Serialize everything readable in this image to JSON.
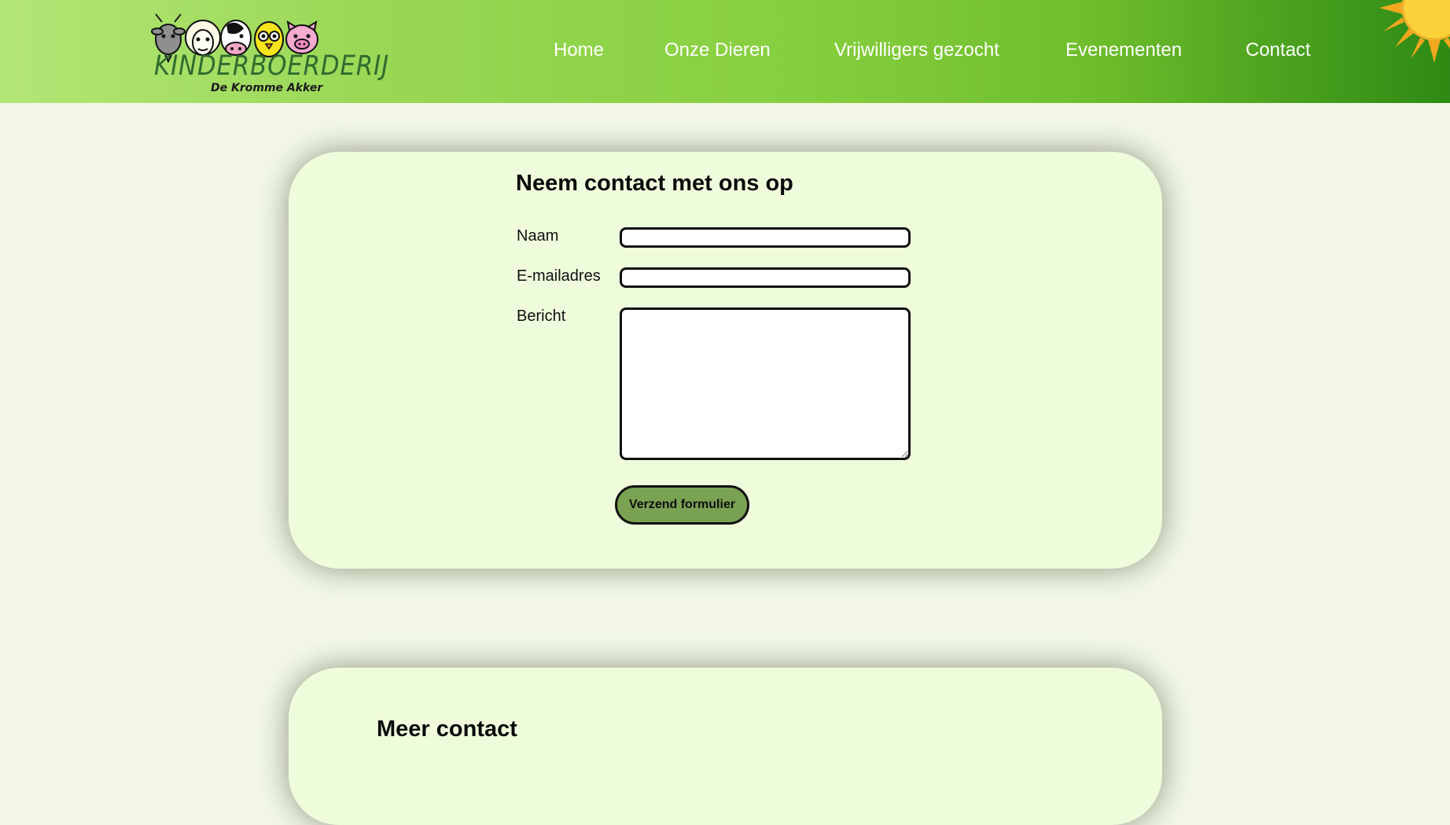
{
  "header": {
    "logo": {
      "title": "KINDERBOERDERIJ",
      "subtitle": "De Kromme Akker",
      "animals": [
        "goat-icon",
        "sheep-icon",
        "cow-icon",
        "chick-icon",
        "pig-icon"
      ]
    },
    "nav": [
      "Home",
      "Onze Dieren",
      "Vrijwilligers gezocht",
      "Evenementen",
      "Contact"
    ],
    "decoration": "sun-icon"
  },
  "contact_form": {
    "title": "Neem contact met ons op",
    "fields": [
      {
        "label": "Naam",
        "value": "",
        "type": "text"
      },
      {
        "label": "E-mailadres",
        "value": "",
        "type": "email"
      },
      {
        "label": "Bericht",
        "value": "",
        "type": "textarea"
      }
    ],
    "submit_label": "Verzend formulier"
  },
  "second_card": {
    "title": "Meer contact"
  },
  "colors": {
    "page_background": "#f3f8e8",
    "card_background": "#eefcdc",
    "header_gradient_start": "#b3e676",
    "header_gradient_end": "#2e8a14",
    "button_background": "#7aa253",
    "sun": "#f7b626"
  }
}
